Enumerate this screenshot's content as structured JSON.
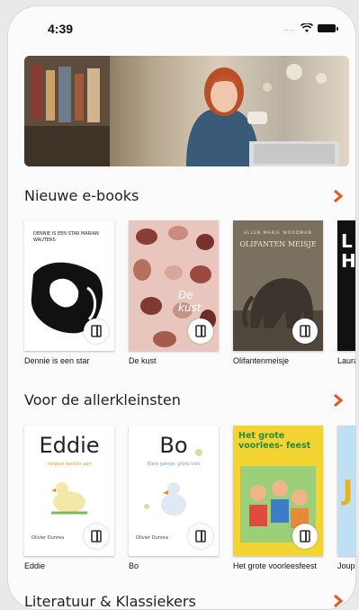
{
  "status": {
    "time": "4:39"
  },
  "sections": [
    {
      "title": "Nieuwe e-books",
      "books": [
        {
          "title": "Dennie is een star",
          "cover_text": "DENNIE IS EEN STAR MARIAN WAUTERS"
        },
        {
          "title": "De kust",
          "cover_text": "De kust"
        },
        {
          "title": "Olifantenmeisje",
          "cover_author": "ELLEN MARIE WOODMAN",
          "cover_text": "OLIFANTEN MEISJE"
        },
        {
          "title": "Laura",
          "cover_text": "L H"
        }
      ]
    },
    {
      "title": "Voor de allerkleinsten",
      "books": [
        {
          "title": "Eddie",
          "cover_text": "Eddie",
          "cover_sub": "vergeet wellets aan",
          "cover_author": "Olivier Dunrea"
        },
        {
          "title": "Bo",
          "cover_text": "Bo",
          "cover_sub": "Klein gansje, grote trek",
          "cover_author": "Olivier Dunrea"
        },
        {
          "title": "Het grote voorleesfeest",
          "cover_text": "Het grote voorlees- feest"
        },
        {
          "title": "Joup",
          "cover_text": "J"
        }
      ]
    },
    {
      "title": "Literatuur & Klassiekers"
    }
  ],
  "colors": {
    "accent": "#e8541e"
  }
}
